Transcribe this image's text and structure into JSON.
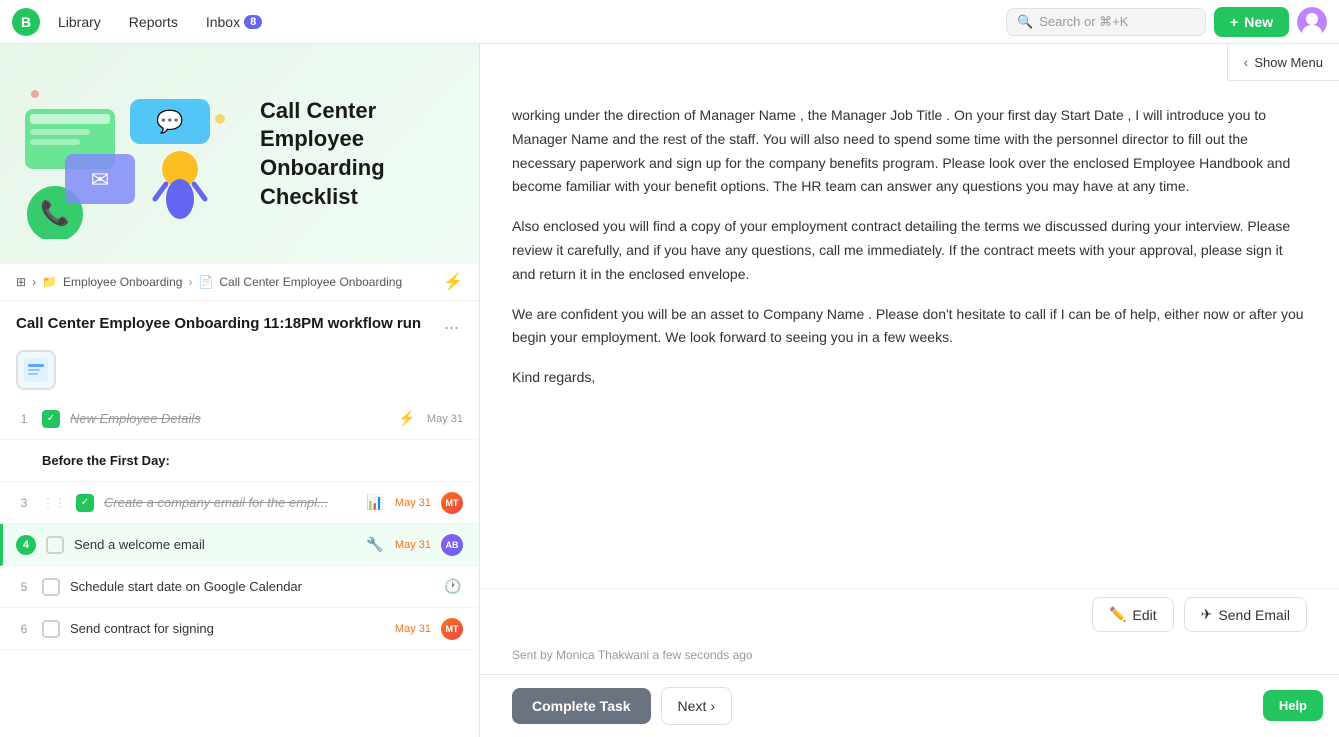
{
  "nav": {
    "logo_text": "B",
    "library_label": "Library",
    "reports_label": "Reports",
    "inbox_label": "Inbox",
    "inbox_badge": "8",
    "search_placeholder": "Search or ⌘+K",
    "new_label": "New"
  },
  "left": {
    "hero_title": "Call Center Employee Onboarding Checklist",
    "breadcrumb": {
      "icon": "📋",
      "part1": "Employee Onboarding",
      "sep1": ">",
      "part2": "Call Center Employee Onboarding"
    },
    "workflow_title": "Call Center Employee Onboarding 11:18PM workflow run",
    "more": "...",
    "tasks": [
      {
        "num": "1",
        "checked": true,
        "text": "New Employee Details",
        "date": "May 31",
        "date_color": "gray",
        "icon": "⚡",
        "has_avatar": false,
        "section": false,
        "done": true
      },
      {
        "num": "",
        "checked": false,
        "text": "Before the First Day:",
        "date": "",
        "icon": "",
        "has_avatar": false,
        "section": true,
        "done": false
      },
      {
        "num": "3",
        "checked": true,
        "text": "Create a company email for the empl...",
        "date": "May 31",
        "date_color": "orange",
        "icon": "📊",
        "has_avatar": true,
        "avatar_type": "orange",
        "section": false,
        "done": true
      },
      {
        "num": "4",
        "checked": false,
        "text": "Send a welcome email",
        "date": "May 31",
        "date_color": "orange",
        "icon": "🔧",
        "has_avatar": true,
        "avatar_type": "purple",
        "section": false,
        "done": false,
        "active": true
      },
      {
        "num": "5",
        "checked": false,
        "text": "Schedule start date on Google Calendar",
        "date": "",
        "date_color": "gray",
        "icon": "🕐",
        "has_avatar": false,
        "section": false,
        "done": false
      },
      {
        "num": "6",
        "checked": false,
        "text": "Send contract for signing",
        "date": "May 31",
        "date_color": "orange",
        "icon": "",
        "has_avatar": true,
        "avatar_type": "orange2",
        "section": false,
        "done": false
      }
    ]
  },
  "right": {
    "email_paragraphs": [
      "working under the direction of  Manager Name , the Manager Job Title . On your first day  Start Date , I will introduce you to  Manager Name  and the rest of the staff. You will also need to spend some time with the personnel director to fill out the necessary paperwork and sign up for the company benefits program. Please look over the enclosed Employee Handbook and become familiar with your benefit options. The HR team can answer any questions you may have at any time.",
      "Also enclosed you will find a copy of your employment contract detailing the terms we discussed during your interview. Please review it carefully, and if you have any questions, call me immediately. If the contract meets with your approval, please sign it and return it in the enclosed envelope.",
      "We are confident you will be an asset to  Company Name . Please don't hesitate to call if I can be of help, either now or after you begin your employment. We look forward to seeing you in a few weeks.",
      "Kind regards,"
    ],
    "edit_label": "Edit",
    "send_email_label": "Send Email",
    "sent_by": "Sent by Monica Thakwani a few seconds ago",
    "complete_task_label": "Complete Task",
    "next_label": "Next",
    "show_menu_label": "Show Menu",
    "help_label": "Help"
  }
}
